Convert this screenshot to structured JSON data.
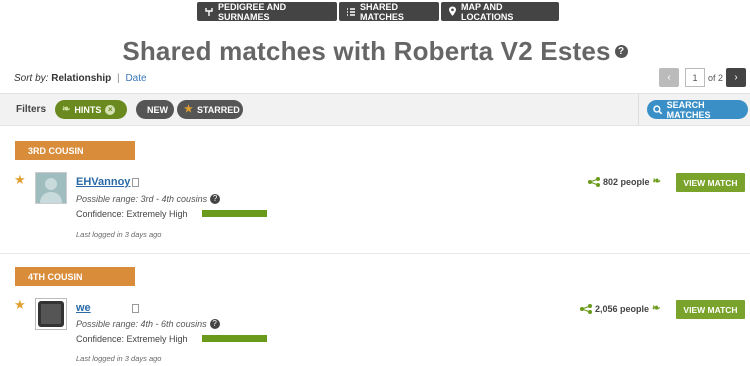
{
  "tabs": [
    {
      "label": "PEDIGREE AND SURNAMES",
      "icon": "pedigree-icon"
    },
    {
      "label": "SHARED MATCHES",
      "icon": "list-icon"
    },
    {
      "label": "MAP AND LOCATIONS",
      "icon": "map-pin-icon"
    }
  ],
  "page": {
    "title": "Shared matches with Roberta V2 Estes",
    "help": "?"
  },
  "sort": {
    "label": "Sort by:",
    "current": "Relationship",
    "separator": "|",
    "alternate": "Date"
  },
  "pager": {
    "prev": "‹",
    "page_value": "1",
    "of_label": "of 2",
    "next": "›"
  },
  "filters": {
    "label": "Filters",
    "hints": "HINTS",
    "new": "NEW",
    "starred": "STARRED",
    "search_button": "SEARCH MATCHES"
  },
  "colors": {
    "accent_green": "#79a32a",
    "badge_orange": "#d98c3a",
    "link_blue": "#2a6aa8",
    "search_blue": "#3b8fc7"
  },
  "matches": [
    {
      "relationship": "3RD COUSIN",
      "name": "EHVannoy",
      "range": "Possible range: 3rd - 4th cousins",
      "confidence": "Confidence: Extremely High",
      "confidence_level": 1.0,
      "logged": "Last logged in 3 days ago",
      "people": "802 people",
      "view_button": "VIEW MATCH",
      "starred": true
    },
    {
      "relationship": "4TH COUSIN",
      "name": "we",
      "range": "Possible range: 4th - 6th cousins",
      "confidence": "Confidence: Extremely High",
      "confidence_level": 1.0,
      "logged": "Last logged in 3 days ago",
      "people": "2,056 people",
      "view_button": "VIEW MATCH",
      "starred": true
    }
  ]
}
